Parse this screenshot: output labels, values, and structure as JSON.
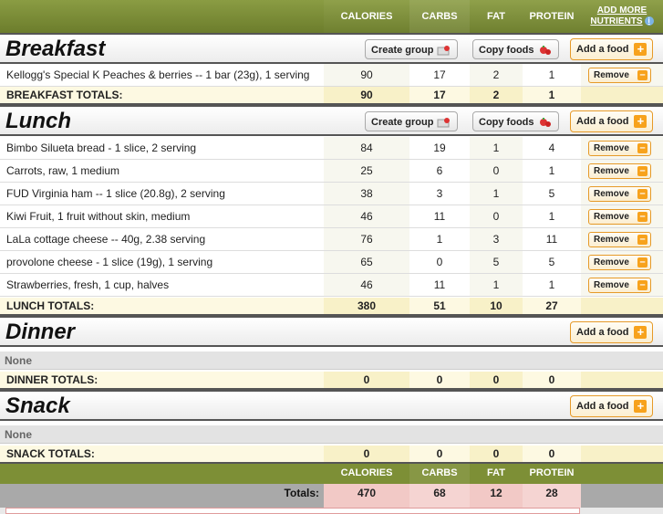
{
  "header": {
    "columns": [
      "CALORIES",
      "CARBS",
      "FAT",
      "PROTEIN"
    ],
    "add_more_line1": "ADD MORE",
    "add_more_line2": "NUTRIENTS",
    "info_icon": "i"
  },
  "buttons": {
    "create_group": "Create group",
    "copy_foods": "Copy foods",
    "add_food": "Add a food",
    "remove": "Remove",
    "plus": "+",
    "minus": "–"
  },
  "meals": {
    "breakfast": {
      "title": "Breakfast",
      "items": [
        {
          "name": "Kellogg's Special K Peaches & berries -- 1 bar (23g), 1 serving",
          "calories": "90",
          "carbs": "17",
          "fat": "2",
          "protein": "1"
        }
      ],
      "totals": {
        "label": "BREAKFAST TOTALS:",
        "calories": "90",
        "carbs": "17",
        "fat": "2",
        "protein": "1"
      }
    },
    "lunch": {
      "title": "Lunch",
      "items": [
        {
          "name": "Bimbo Silueta bread - 1 slice, 2 serving",
          "calories": "84",
          "carbs": "19",
          "fat": "1",
          "protein": "4"
        },
        {
          "name": "Carrots, raw, 1 medium",
          "calories": "25",
          "carbs": "6",
          "fat": "0",
          "protein": "1"
        },
        {
          "name": "FUD Virginia ham -- 1 slice (20.8g), 2 serving",
          "calories": "38",
          "carbs": "3",
          "fat": "1",
          "protein": "5"
        },
        {
          "name": "Kiwi Fruit, 1 fruit without skin, medium",
          "calories": "46",
          "carbs": "11",
          "fat": "0",
          "protein": "1"
        },
        {
          "name": "LaLa cottage cheese -- 40g, 2.38 serving",
          "calories": "76",
          "carbs": "1",
          "fat": "3",
          "protein": "11"
        },
        {
          "name": "provolone cheese - 1 slice (19g), 1 serving",
          "calories": "65",
          "carbs": "0",
          "fat": "5",
          "protein": "5"
        },
        {
          "name": "Strawberries, fresh, 1 cup, halves",
          "calories": "46",
          "carbs": "11",
          "fat": "1",
          "protein": "1"
        }
      ],
      "totals": {
        "label": "LUNCH TOTALS:",
        "calories": "380",
        "carbs": "51",
        "fat": "10",
        "protein": "27"
      }
    },
    "dinner": {
      "title": "Dinner",
      "none_label": "None",
      "totals": {
        "label": "DINNER TOTALS:",
        "calories": "0",
        "carbs": "0",
        "fat": "0",
        "protein": "0"
      }
    },
    "snack": {
      "title": "Snack",
      "none_label": "None",
      "totals": {
        "label": "SNACK TOTALS:",
        "calories": "0",
        "carbs": "0",
        "fat": "0",
        "protein": "0"
      }
    }
  },
  "summary": {
    "columns": [
      "CALORIES",
      "CARBS",
      "FAT",
      "PROTEIN"
    ],
    "label": "Totals:",
    "calories": "470",
    "carbs": "68",
    "fat": "12",
    "protein": "28"
  },
  "colors": {
    "header_green": "#7d8f36",
    "accent_orange": "#f7a21c",
    "totals_yellow": "#fdf9e2"
  }
}
